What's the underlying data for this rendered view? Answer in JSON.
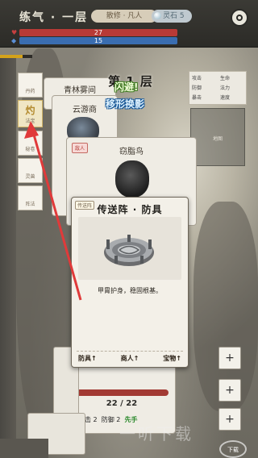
{
  "header": {
    "realm": "练气 · 一层",
    "rank": "散修 · 凡人",
    "stone_label": "灵石",
    "stone_value": "5",
    "hp": "27",
    "hp_fill": 1.0,
    "mp": "15",
    "mp_fill": 1.0
  },
  "floor": {
    "title": "第 1 层",
    "float_dodge": "闪避!",
    "float_skill": "移形换影"
  },
  "side_tabs": [
    {
      "label": "",
      "sub": "丹药",
      "active": false
    },
    {
      "label": "灼",
      "sub": "法宝",
      "active": true
    },
    {
      "label": "",
      "sub": "秘卷",
      "active": false
    },
    {
      "label": "",
      "sub": "灵兽",
      "active": false
    },
    {
      "label": "",
      "sub": "阵法",
      "active": false
    }
  ],
  "stats_panel": {
    "items": [
      "攻击",
      "防御",
      "暴击",
      "生命",
      "法力",
      "速度"
    ]
  },
  "minimap_label": "地图",
  "stack_cards": {
    "card1_title": "青林雾间",
    "card2_title": "云游商",
    "card3_title": "窃脂鸟",
    "card3_tag": "敌人"
  },
  "main_card": {
    "badge": "传送阵",
    "title": "传送阵 · 防具",
    "description": "甲胄护身，稳固根基。",
    "chips": [
      "防具↑",
      "商人↑",
      "宝物↑"
    ]
  },
  "enemy": {
    "hp": "22 / 22",
    "attack": "攻击 2",
    "defense": "防御 2",
    "first": "先手"
  },
  "watermark": "一听下载",
  "download_label": "下载",
  "colors": {
    "hp": "#b83a36",
    "mp": "#3a6db0",
    "accent": "#d4a21a",
    "arrow": "#e03a3a"
  }
}
